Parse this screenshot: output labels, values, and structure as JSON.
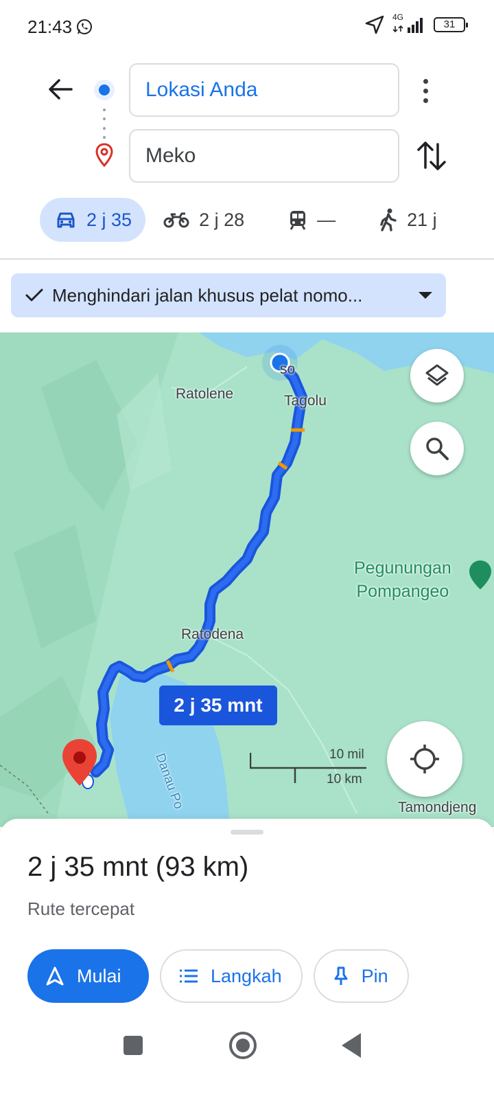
{
  "status_bar": {
    "time": "21:43",
    "network": "4G",
    "battery": "31",
    "icons": [
      "whatsapp-icon",
      "location-arrow-icon",
      "signal-icon",
      "battery-icon"
    ]
  },
  "route": {
    "origin": "Lokasi Anda",
    "destination": "Meko",
    "modes": [
      {
        "name": "car",
        "icon": "car-icon",
        "label": "2 j 35"
      },
      {
        "name": "motorcycle",
        "icon": "motorcycle-icon",
        "label": "2 j 28"
      },
      {
        "name": "transit",
        "icon": "train-icon",
        "label": "—"
      },
      {
        "name": "walk",
        "icon": "walk-icon",
        "label": "21 j"
      }
    ]
  },
  "avoid_chip": {
    "label": "Menghindari jalan khusus pelat nomo..."
  },
  "map": {
    "labels": {
      "poso": "so",
      "ratolene": "Ratolene",
      "tagolu": "Tagolu",
      "ratodena": "Ratodena",
      "park_line1": "Pegunungan",
      "park_line2": "Pompangeo",
      "lake": "Danau Po",
      "tamondjeng": "Tamondjeng"
    },
    "eta_badge": "2 j 35 mnt",
    "scale_mi": "10 mil",
    "scale_km": "10 km",
    "colors": {
      "route": "#1a56db",
      "land": "#a9e2c9",
      "water": "#8fd3ee",
      "pin": "#d93025"
    }
  },
  "sheet": {
    "summary": "2 j 35 mnt (93 km)",
    "subtitle": "Rute tercepat",
    "start_label": "Mulai",
    "steps_label": "Langkah",
    "pin_label": "Pin"
  }
}
